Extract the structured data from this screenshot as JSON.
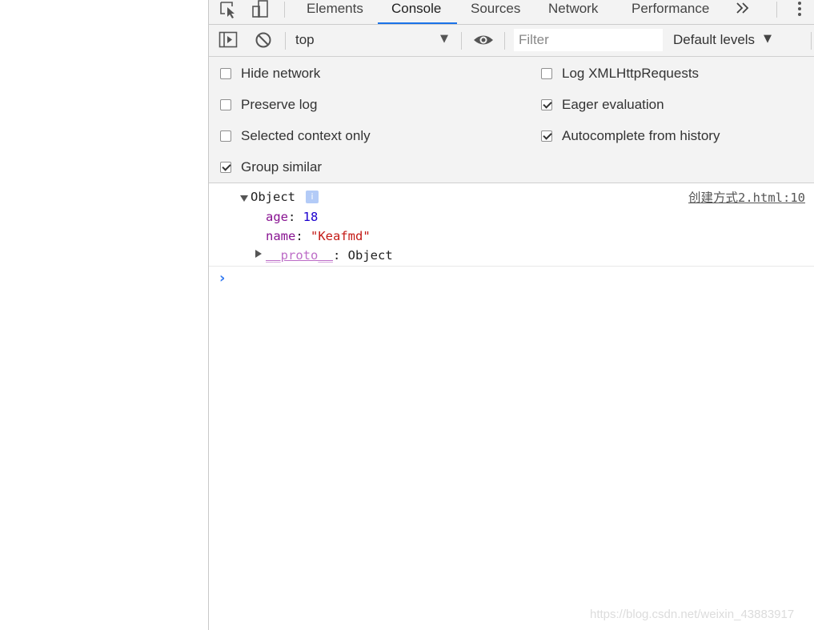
{
  "tabs": [
    {
      "label": "Elements"
    },
    {
      "label": "Console"
    },
    {
      "label": "Sources"
    },
    {
      "label": "Network"
    },
    {
      "label": "Performance"
    }
  ],
  "toolbar": {
    "context": "top",
    "filter_placeholder": "Filter",
    "levels_label": "Default levels"
  },
  "settings": {
    "left": [
      {
        "label": "Hide network",
        "checked": false
      },
      {
        "label": "Preserve log",
        "checked": false
      },
      {
        "label": "Selected context only",
        "checked": false
      },
      {
        "label": "Group similar",
        "checked": true
      }
    ],
    "right": [
      {
        "label": "Log XMLHttpRequests",
        "checked": false
      },
      {
        "label": "Eager evaluation",
        "checked": true
      },
      {
        "label": "Autocomplete from history",
        "checked": true
      }
    ]
  },
  "log": {
    "object_label": "Object",
    "info_badge": "i",
    "source": "创建方式2.html:10",
    "props": [
      {
        "key": "age",
        "value": "18"
      },
      {
        "key": "name",
        "value": "\"Keafmd\""
      }
    ],
    "proto_key": "__proto__",
    "proto_value": "Object"
  },
  "prompt_symbol": "›",
  "watermark": "https://blog.csdn.net/weixin_43883917",
  "colors": {
    "accent": "#1a73e8",
    "prompt": "#367cf1",
    "key": "#881391",
    "number": "#1c00cf",
    "string": "#c41a16"
  }
}
